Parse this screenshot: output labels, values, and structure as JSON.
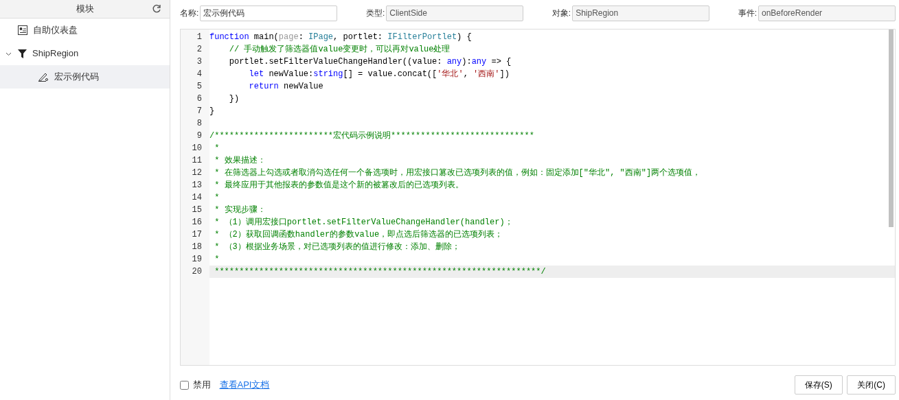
{
  "sidebar": {
    "title": "模块",
    "items": [
      {
        "label": "自助仪表盘",
        "kind": "dashboard",
        "selected": false
      },
      {
        "label": "ShipRegion",
        "kind": "filter",
        "selected": false,
        "expanded": true,
        "children": [
          {
            "label": "宏示例代码",
            "kind": "macro",
            "selected": true
          }
        ]
      }
    ]
  },
  "fields": [
    {
      "label": "名称:",
      "value": "宏示例代码",
      "disabled": false
    },
    {
      "label": "类型:",
      "value": "ClientSide",
      "disabled": true
    },
    {
      "label": "对象:",
      "value": "ShipRegion",
      "disabled": true
    },
    {
      "label": "事件:",
      "value": "onBeforeRender",
      "disabled": true
    }
  ],
  "editor": {
    "lines": [
      {
        "number": "1",
        "active": false,
        "tokens": [
          {
            "kind": "keyword",
            "text": "function"
          },
          {
            "kind": "plain",
            "text": " main("
          },
          {
            "kind": "param",
            "text": "page"
          },
          {
            "kind": "plain",
            "text": ": "
          },
          {
            "kind": "type",
            "text": "IPage"
          },
          {
            "kind": "plain",
            "text": ", portlet: "
          },
          {
            "kind": "type",
            "text": "IFilterPortlet"
          },
          {
            "kind": "plain",
            "text": ") {"
          }
        ]
      },
      {
        "number": "2",
        "active": false,
        "tokens": [
          {
            "kind": "comment",
            "text": "    // 手动触发了筛选器值value变更时，可以再对value处理"
          }
        ]
      },
      {
        "number": "3",
        "active": false,
        "tokens": [
          {
            "kind": "plain",
            "text": "    portlet.setFilterValueChangeHandler((value: "
          },
          {
            "kind": "keyword",
            "text": "any"
          },
          {
            "kind": "plain",
            "text": "):"
          },
          {
            "kind": "keyword",
            "text": "any"
          },
          {
            "kind": "plain",
            "text": " => {"
          }
        ]
      },
      {
        "number": "4",
        "active": false,
        "tokens": [
          {
            "kind": "keyword",
            "text": "        let"
          },
          {
            "kind": "plain",
            "text": " newValue:"
          },
          {
            "kind": "keyword",
            "text": "string"
          },
          {
            "kind": "plain",
            "text": "[] = value.concat(["
          },
          {
            "kind": "string",
            "text": "'华北'"
          },
          {
            "kind": "plain",
            "text": ", "
          },
          {
            "kind": "string",
            "text": "'西南'"
          },
          {
            "kind": "plain",
            "text": "])"
          }
        ]
      },
      {
        "number": "5",
        "active": false,
        "tokens": [
          {
            "kind": "keyword",
            "text": "        return"
          },
          {
            "kind": "plain",
            "text": " newValue"
          }
        ]
      },
      {
        "number": "6",
        "active": false,
        "tokens": [
          {
            "kind": "plain",
            "text": "    })"
          }
        ]
      },
      {
        "number": "7",
        "active": false,
        "tokens": [
          {
            "kind": "plain",
            "text": "}"
          }
        ]
      },
      {
        "number": "8",
        "active": false
      },
      {
        "number": "9",
        "active": false,
        "tokens": [
          {
            "kind": "comment",
            "text": "/************************宏代码示例说明*****************************"
          }
        ]
      },
      {
        "number": "10",
        "active": false,
        "tokens": [
          {
            "kind": "comment",
            "text": " *"
          }
        ]
      },
      {
        "number": "11",
        "active": false,
        "tokens": [
          {
            "kind": "comment",
            "text": " * 效果描述："
          }
        ]
      },
      {
        "number": "12",
        "active": false,
        "tokens": [
          {
            "kind": "comment",
            "text": " * 在筛选器上勾选或者取消勾选任何一个备选项时，用宏接口篡改已选项列表的值，例如：固定添加[\"华北\", \"西南\"]两个选项值，"
          }
        ]
      },
      {
        "number": "13",
        "active": false,
        "tokens": [
          {
            "kind": "comment",
            "text": " * 最终应用于其他报表的参数值是这个新的被篡改后的已选项列表。"
          }
        ]
      },
      {
        "number": "14",
        "active": false,
        "tokens": [
          {
            "kind": "comment",
            "text": " *"
          }
        ]
      },
      {
        "number": "15",
        "active": false,
        "tokens": [
          {
            "kind": "comment",
            "text": " * 实现步骤："
          }
        ]
      },
      {
        "number": "16",
        "active": false,
        "tokens": [
          {
            "kind": "comment",
            "text": " * （1）调用宏接口portlet.setFilterValueChangeHandler(handler)；"
          }
        ]
      },
      {
        "number": "17",
        "active": false,
        "tokens": [
          {
            "kind": "comment",
            "text": " * （2）获取回调函数handler的参数value，即点选后筛选器的已选项列表；"
          }
        ]
      },
      {
        "number": "18",
        "active": false,
        "tokens": [
          {
            "kind": "comment",
            "text": " * （3）根据业务场景，对已选项列表的值进行修改：添加、删除；"
          }
        ]
      },
      {
        "number": "19",
        "active": false,
        "tokens": [
          {
            "kind": "comment",
            "text": " *"
          }
        ]
      },
      {
        "number": "20",
        "active": true,
        "tokens": [
          {
            "kind": "comment",
            "text": " ******************************************************************/"
          }
        ]
      }
    ]
  },
  "footer": {
    "disable_checkbox": {
      "label": "禁用",
      "checked": false
    },
    "link": "查看API文档",
    "buttons": [
      "保存(S)",
      "关闭(C)"
    ]
  }
}
